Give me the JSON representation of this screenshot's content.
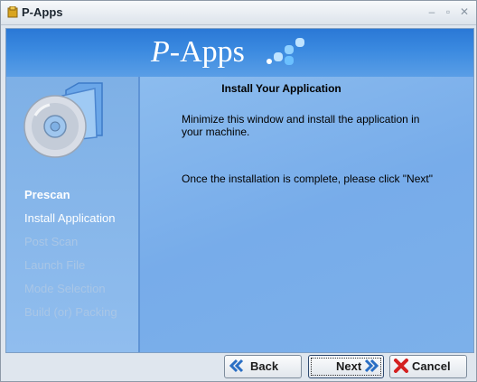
{
  "window": {
    "title": "P-Apps",
    "controls": [
      "minimize",
      "maximize",
      "close"
    ]
  },
  "header": {
    "logo_p": "P",
    "logo_rest": "-Apps"
  },
  "steps": [
    {
      "label": "Prescan",
      "state": "done"
    },
    {
      "label": "Install Application",
      "state": "active"
    },
    {
      "label": "Post Scan",
      "state": "pending"
    },
    {
      "label": "Launch File",
      "state": "pending"
    },
    {
      "label": "Mode Selection",
      "state": "pending"
    },
    {
      "label": "Build (or) Packing",
      "state": "pending"
    }
  ],
  "main": {
    "title": "Install Your Application",
    "message1": "Minimize this window and install the application in your machine.",
    "message2": "Once the installation is complete, please click \"Next\""
  },
  "buttons": {
    "back": "Back",
    "next": "Next",
    "cancel": "Cancel"
  },
  "colors": {
    "header": "#2a78d6",
    "panel": "#7fb0e4",
    "cancel_icon": "#d42020",
    "nav_icon": "#2a6fc4"
  }
}
